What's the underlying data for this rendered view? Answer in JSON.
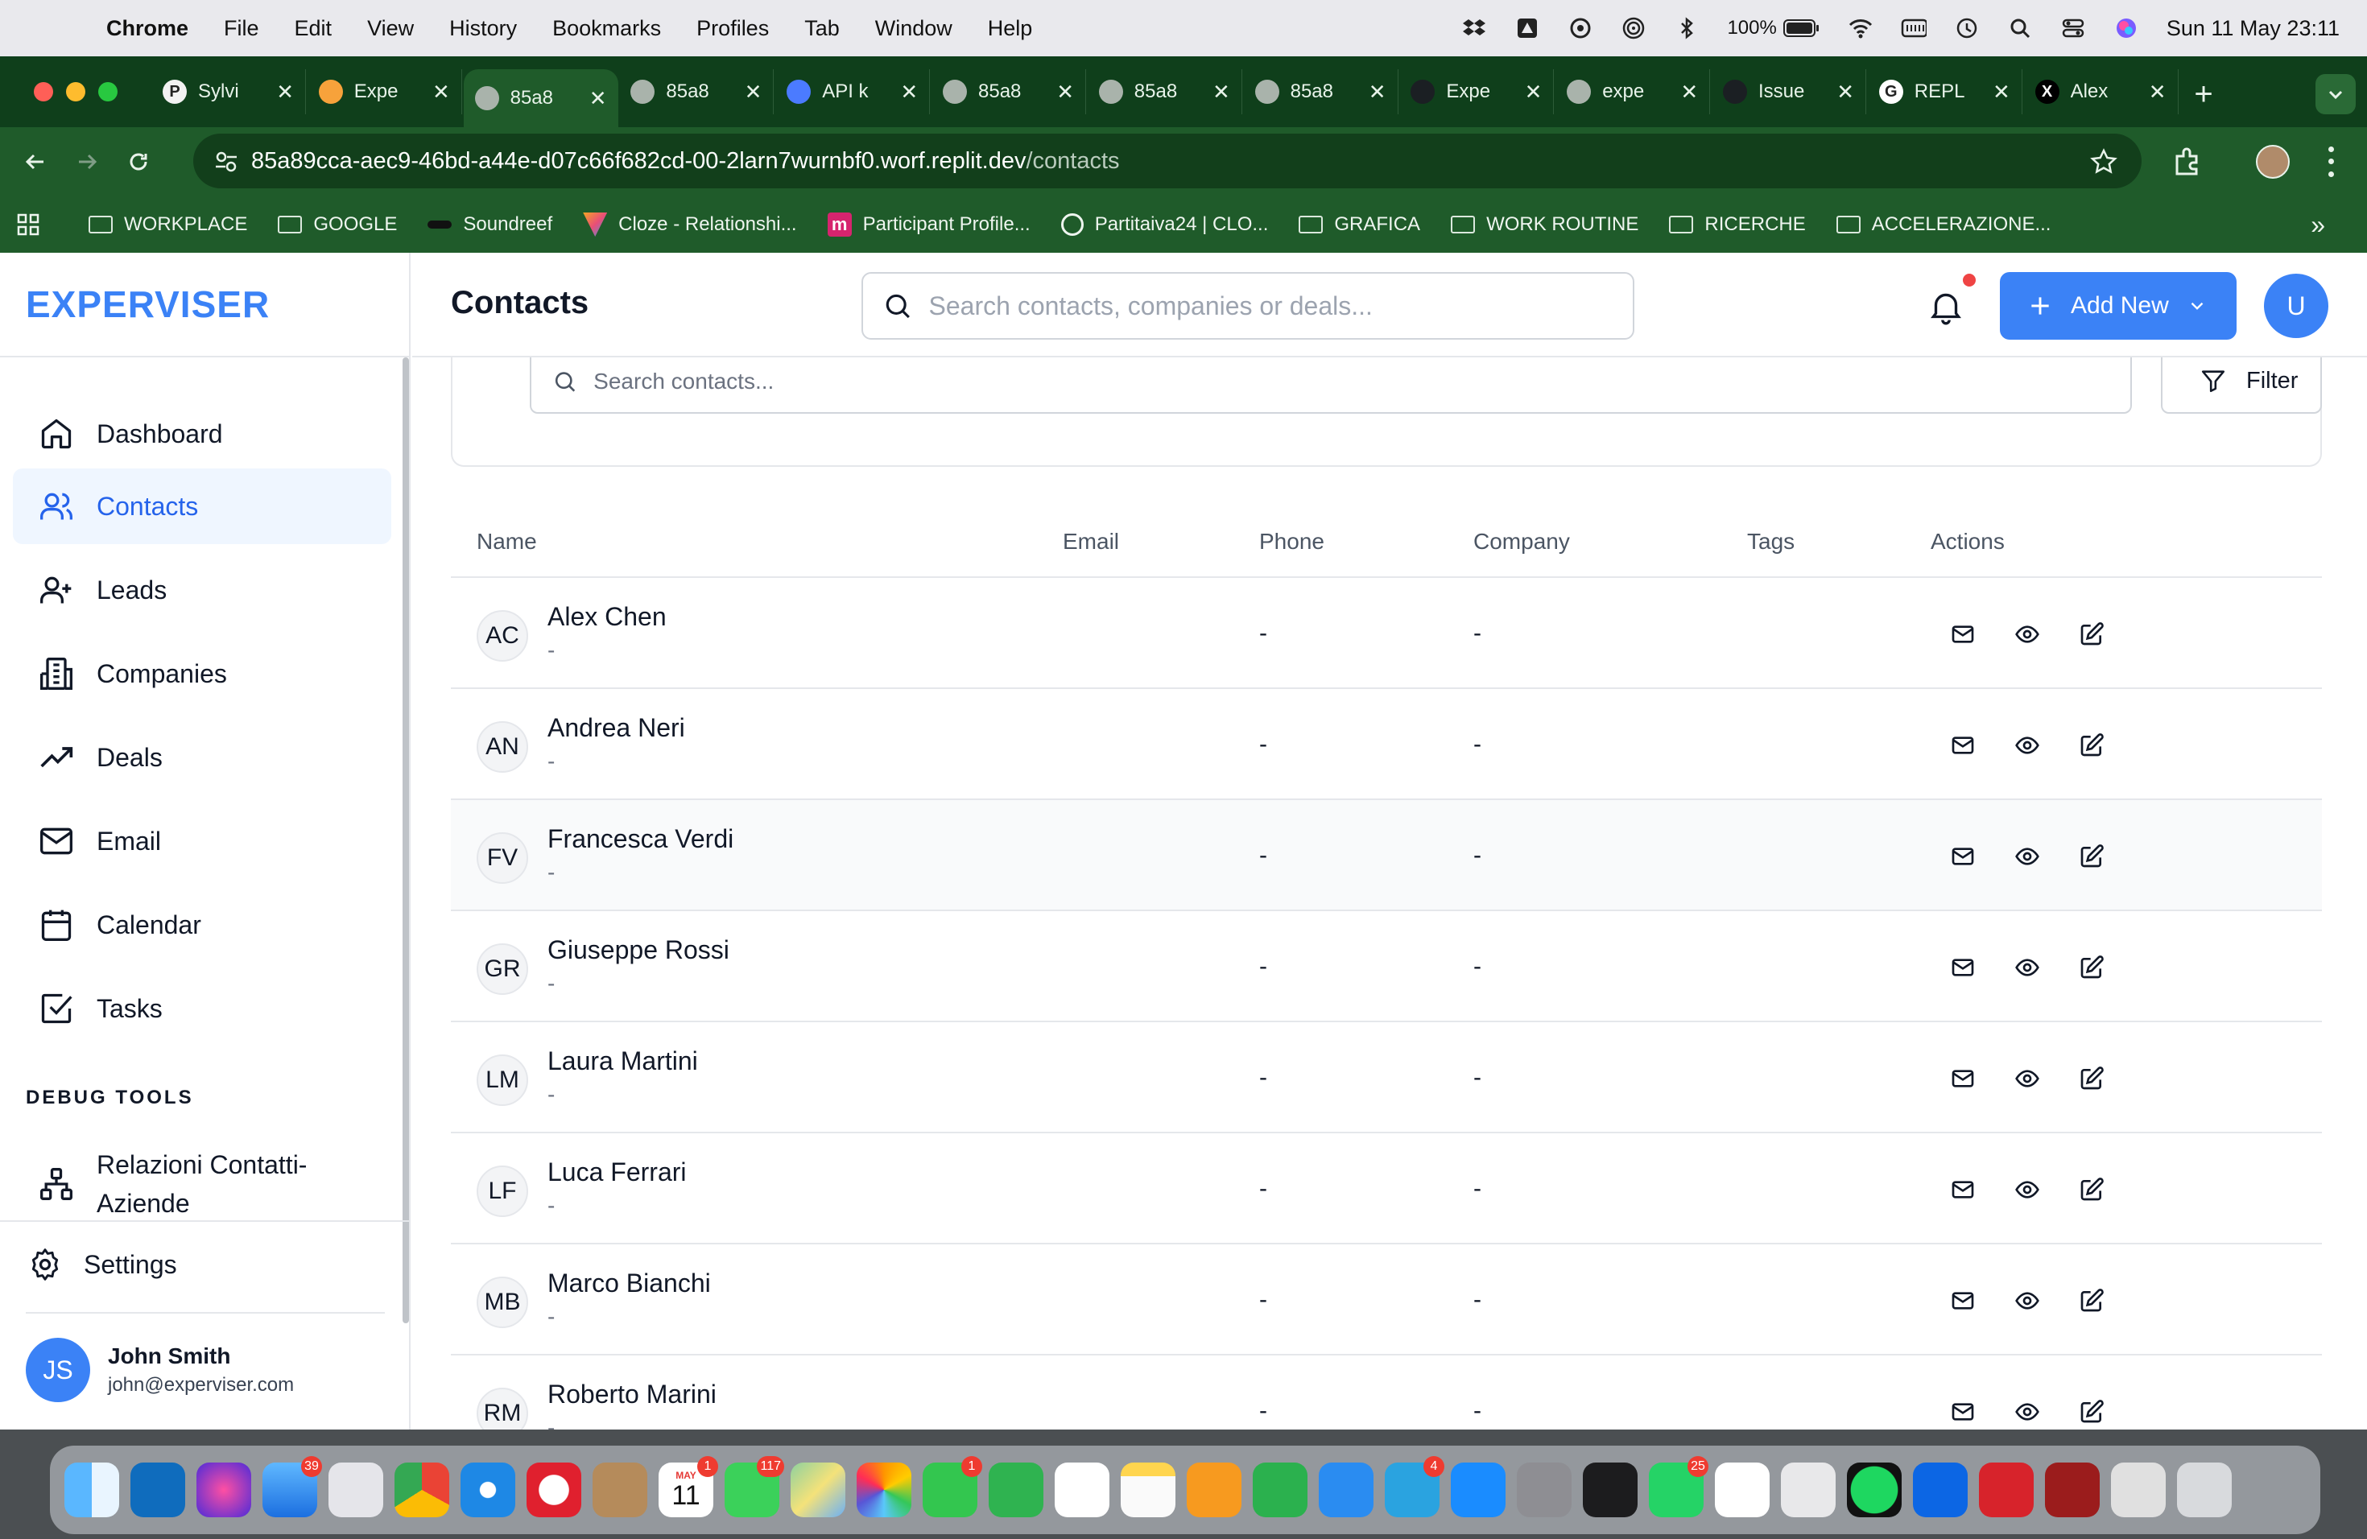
{
  "menubar": {
    "app": "Chrome",
    "items": [
      "File",
      "Edit",
      "View",
      "History",
      "Bookmarks",
      "Profiles",
      "Tab",
      "Window",
      "Help"
    ],
    "battery": "100%",
    "clock": "Sun 11 May  23:11"
  },
  "tabs": [
    {
      "label": "Sylvi",
      "icon": "p-icon"
    },
    {
      "label": "Expe",
      "icon": "grid-icon"
    },
    {
      "label": "85a8",
      "icon": "globe-icon",
      "active": true
    },
    {
      "label": "85a8",
      "icon": "globe-icon"
    },
    {
      "label": "API k",
      "icon": "openai-icon"
    },
    {
      "label": "85a8",
      "icon": "globe-icon"
    },
    {
      "label": "85a8",
      "icon": "globe-icon"
    },
    {
      "label": "85a8",
      "icon": "globe-icon"
    },
    {
      "label": "Expe",
      "icon": "github-icon"
    },
    {
      "label": "expe",
      "icon": "globe-icon"
    },
    {
      "label": "Issue",
      "icon": "github-icon"
    },
    {
      "label": "REPL",
      "icon": "google-icon"
    },
    {
      "label": "Alex",
      "icon": "x-icon"
    }
  ],
  "browser": {
    "url_host": "85a89cca-aec9-46bd-a44e-d07c66f682cd-00-2larn7wurnbf0.worf.replit.dev",
    "url_path": "/contacts"
  },
  "bookmarks": [
    "WORKPLACE",
    "GOOGLE",
    "Soundreef",
    "Cloze - Relationshi...",
    "Participant Profile...",
    "Partitaiva24 | CLO...",
    "GRAFICA",
    "WORK ROUTINE",
    "RICERCHE",
    "ACCELERAZIONE..."
  ],
  "sidebar": {
    "brand": "EXPERVISER",
    "items": [
      {
        "label": "Dashboard",
        "icon": "home-icon"
      },
      {
        "label": "Contacts",
        "icon": "users-icon",
        "active": true
      },
      {
        "label": "Leads",
        "icon": "user-plus-icon"
      },
      {
        "label": "Companies",
        "icon": "building-icon"
      },
      {
        "label": "Deals",
        "icon": "trending-up-icon"
      },
      {
        "label": "Email",
        "icon": "mail-icon"
      },
      {
        "label": "Calendar",
        "icon": "calendar-icon"
      },
      {
        "label": "Tasks",
        "icon": "check-square-icon"
      }
    ],
    "debug_title": "DEBUG TOOLS",
    "debug_item": "Relazioni Contatti-Aziende",
    "settings": "Settings",
    "user": {
      "initials": "JS",
      "name": "John Smith",
      "email": "john@experviser.com"
    }
  },
  "header": {
    "title": "Contacts",
    "search_placeholder": "Search contacts, companies or deals...",
    "add_new": "Add New",
    "avatar": "U"
  },
  "filters": {
    "search_placeholder": "Search contacts...",
    "filter_label": "Filter"
  },
  "table": {
    "columns": [
      "Name",
      "Email",
      "Phone",
      "Company",
      "Tags",
      "Actions"
    ],
    "rows": [
      {
        "initials": "AC",
        "name": "Alex Chen",
        "sub": "-",
        "phone": "-",
        "company": "-"
      },
      {
        "initials": "AN",
        "name": "Andrea Neri",
        "sub": "-",
        "phone": "-",
        "company": "-"
      },
      {
        "initials": "FV",
        "name": "Francesca Verdi",
        "sub": "-",
        "phone": "-",
        "company": "-"
      },
      {
        "initials": "GR",
        "name": "Giuseppe Rossi",
        "sub": "-",
        "phone": "-",
        "company": "-"
      },
      {
        "initials": "LM",
        "name": "Laura Martini",
        "sub": "-",
        "phone": "-",
        "company": "-"
      },
      {
        "initials": "LF",
        "name": "Luca Ferrari",
        "sub": "-",
        "phone": "-",
        "company": "-"
      },
      {
        "initials": "MB",
        "name": "Marco Bianchi",
        "sub": "-",
        "phone": "-",
        "company": "-"
      },
      {
        "initials": "RM",
        "name": "Roberto Marini",
        "sub": "-",
        "phone": "-",
        "company": "-"
      }
    ]
  },
  "dock": {
    "badges": {
      "mail": "39",
      "calendar": "1",
      "messages": "117",
      "facetime": "1",
      "telegram": "4",
      "whatsapp": "25"
    },
    "calendar_month": "MAY",
    "calendar_day": "11"
  },
  "colors": {
    "accent": "#3b82f6",
    "chrome_dark": "#0f3f1b",
    "chrome": "#1f5b2a"
  }
}
